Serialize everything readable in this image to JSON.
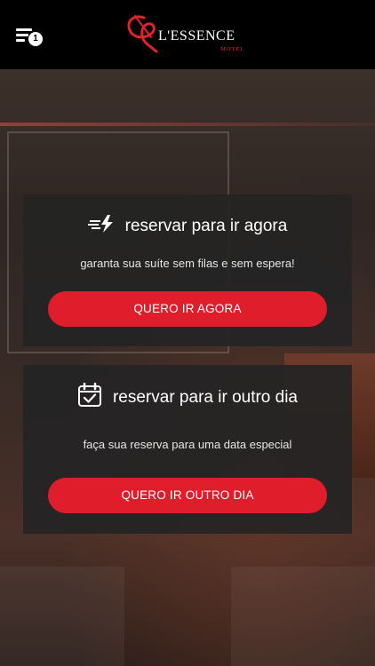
{
  "header": {
    "menu_badge": "1",
    "logo": {
      "name": "L'ESSENCE",
      "sub": "MOTEL"
    }
  },
  "cards": [
    {
      "title": "reservar para ir agora",
      "subtitle": "garanta sua suíte sem filas e sem espera!",
      "button": "QUERO IR AGORA",
      "icon": "fast-lightning-icon"
    },
    {
      "title": "reservar para ir outro dia",
      "subtitle": "faça sua reserva para uma data especial",
      "button": "QUERO IR OUTRO DIA",
      "icon": "calendar-check-icon"
    }
  ],
  "colors": {
    "accent": "#e01d2b",
    "header_bg": "#000000",
    "card_bg": "#242424"
  }
}
